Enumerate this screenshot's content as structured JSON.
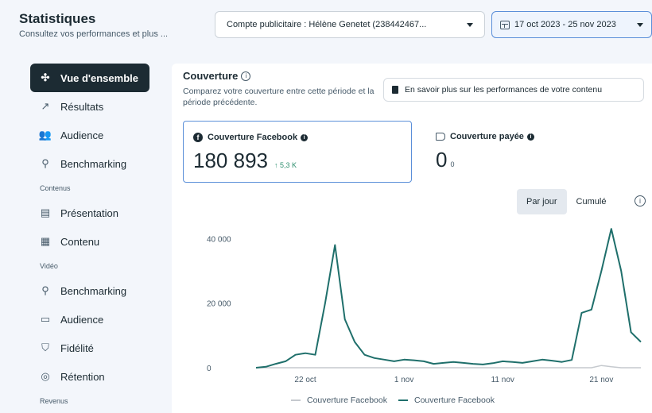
{
  "header": {
    "title": "Statistiques",
    "subtitle": "Consultez vos performances et plus ...",
    "account_select": "Compte publicitaire : Hélène Genetet (238442467...",
    "date_range": "17 oct 2023 - 25 nov 2023"
  },
  "sidebar": {
    "items": [
      {
        "label": "Vue d'ensemble",
        "icon": "overview-icon"
      },
      {
        "label": "Résultats",
        "icon": "results-icon"
      },
      {
        "label": "Audience",
        "icon": "audience-icon"
      },
      {
        "label": "Benchmarking",
        "icon": "benchmark-icon"
      }
    ],
    "section_contenus": "Contenus",
    "contenus_items": [
      {
        "label": "Présentation",
        "icon": "presentation-icon"
      },
      {
        "label": "Contenu",
        "icon": "content-grid-icon"
      }
    ],
    "section_video": "Vidéo",
    "video_items": [
      {
        "label": "Benchmarking",
        "icon": "benchmark-icon"
      },
      {
        "label": "Audience",
        "icon": "video-audience-icon"
      },
      {
        "label": "Fidélité",
        "icon": "loyalty-icon"
      },
      {
        "label": "Rétention",
        "icon": "retention-icon"
      }
    ],
    "section_revenus": "Revenus"
  },
  "main": {
    "title": "Couverture",
    "description": "Comparez votre couverture entre cette période et la période précédente.",
    "learn_more": "En savoir plus sur les performances de votre contenu",
    "card_fb": {
      "label": "Couverture Facebook",
      "value": "180 893",
      "delta": "↑ 5,3 K"
    },
    "card_paid": {
      "label": "Couverture payée",
      "value": "0",
      "delta": "0"
    },
    "toggle": {
      "per_day": "Par jour",
      "cumulative": "Cumulé"
    }
  },
  "chart_data": {
    "type": "line",
    "x": [
      "17 oct",
      "18 oct",
      "19 oct",
      "20 oct",
      "21 oct",
      "22 oct",
      "23 oct",
      "24 oct",
      "25 oct",
      "26 oct",
      "27 oct",
      "28 oct",
      "29 oct",
      "30 oct",
      "31 oct",
      "1 nov",
      "2 nov",
      "3 nov",
      "4 nov",
      "5 nov",
      "6 nov",
      "7 nov",
      "8 nov",
      "9 nov",
      "10 nov",
      "11 nov",
      "12 nov",
      "13 nov",
      "14 nov",
      "15 nov",
      "16 nov",
      "17 nov",
      "18 nov",
      "19 nov",
      "20 nov",
      "21 nov",
      "22 nov",
      "23 nov",
      "24 nov",
      "25 nov"
    ],
    "series": [
      {
        "name": "Couverture Facebook",
        "color": "#c5c9ce",
        "values": [
          0,
          0,
          0,
          0,
          0,
          0,
          0,
          0,
          0,
          0,
          0,
          0,
          0,
          0,
          0,
          0,
          0,
          0,
          0,
          0,
          0,
          0,
          0,
          0,
          0,
          0,
          0,
          0,
          0,
          0,
          0,
          0,
          0,
          0,
          0,
          700,
          300,
          0,
          0,
          0
        ]
      },
      {
        "name": "Couverture Facebook",
        "color": "#1f6f6b",
        "values": [
          0,
          300,
          1200,
          2000,
          4000,
          4500,
          4000,
          20000,
          38000,
          15000,
          8000,
          4000,
          3000,
          2500,
          2000,
          2500,
          2300,
          2000,
          1200,
          1500,
          1800,
          1500,
          1200,
          1000,
          1400,
          2000,
          1800,
          1500,
          2000,
          2500,
          2200,
          1800,
          2400,
          17000,
          18000,
          30000,
          43000,
          30000,
          11000,
          8000
        ]
      }
    ],
    "yticks": [
      "40 000",
      "20 000",
      "0"
    ],
    "ytick_values": [
      40000,
      20000,
      0
    ],
    "xticks": [
      "22 oct",
      "1 nov",
      "11 nov",
      "21 nov"
    ],
    "ylim": [
      0,
      45000
    ]
  }
}
